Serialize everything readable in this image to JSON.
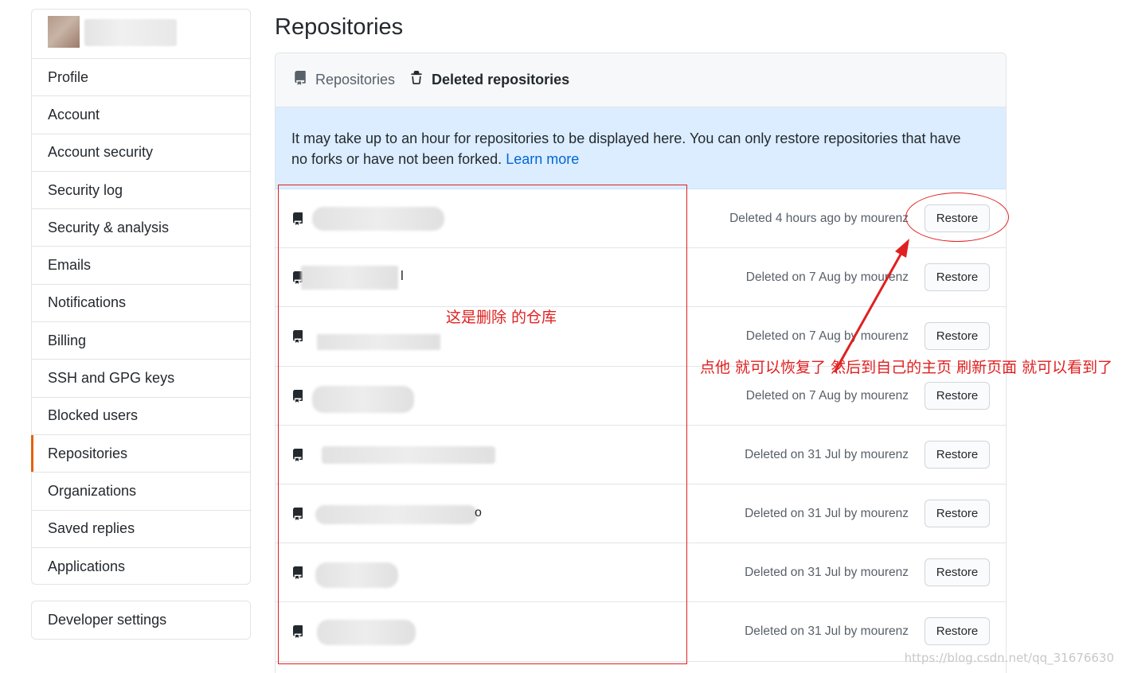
{
  "sidebar": {
    "items": [
      {
        "label": "Profile"
      },
      {
        "label": "Account"
      },
      {
        "label": "Account security"
      },
      {
        "label": "Security log"
      },
      {
        "label": "Security & analysis"
      },
      {
        "label": "Emails"
      },
      {
        "label": "Notifications"
      },
      {
        "label": "Billing"
      },
      {
        "label": "SSH and GPG keys"
      },
      {
        "label": "Blocked users"
      },
      {
        "label": "Repositories",
        "selected": true
      },
      {
        "label": "Organizations"
      },
      {
        "label": "Saved replies"
      },
      {
        "label": "Applications"
      }
    ],
    "developer_settings": "Developer settings",
    "selected_accent": "#e36209"
  },
  "main": {
    "title": "Repositories",
    "tabs": [
      {
        "label": "Repositories",
        "icon": "repo-icon"
      },
      {
        "label": "Deleted repositories",
        "icon": "trash-icon",
        "active": true
      }
    ],
    "notice": {
      "text": "It may take up to an hour for repositories to be displayed here. You can only restore repositories that have no forks or have not been forked.",
      "link": "Learn more"
    },
    "rows": [
      {
        "meta": "Deleted 4 hours ago by mourenz",
        "restore": "Restore",
        "suffix": ""
      },
      {
        "meta": "Deleted on 7 Aug by mourenz",
        "restore": "Restore",
        "suffix": "l"
      },
      {
        "meta": "Deleted on 7 Aug by mourenz",
        "restore": "Restore",
        "suffix": ""
      },
      {
        "meta": "Deleted on 7 Aug by mourenz",
        "restore": "Restore",
        "suffix": ""
      },
      {
        "meta": "Deleted on 31 Jul by mourenz",
        "restore": "Restore",
        "suffix": ""
      },
      {
        "meta": "Deleted on 31 Jul by mourenz",
        "restore": "Restore",
        "suffix": "o"
      },
      {
        "meta": "Deleted on 31 Jul by mourenz",
        "restore": "Restore",
        "suffix": ""
      },
      {
        "meta": "Deleted on 31 Jul by mourenz",
        "restore": "Restore",
        "suffix": ""
      }
    ]
  },
  "annotations": {
    "deleted_label": "这是删除 的仓库",
    "instruction": "点他 就可以恢复了 然后到自己的主页 刷新页面 就可以看到了",
    "color": "#e02020"
  },
  "watermark": "https://blog.csdn.net/qq_31676630"
}
